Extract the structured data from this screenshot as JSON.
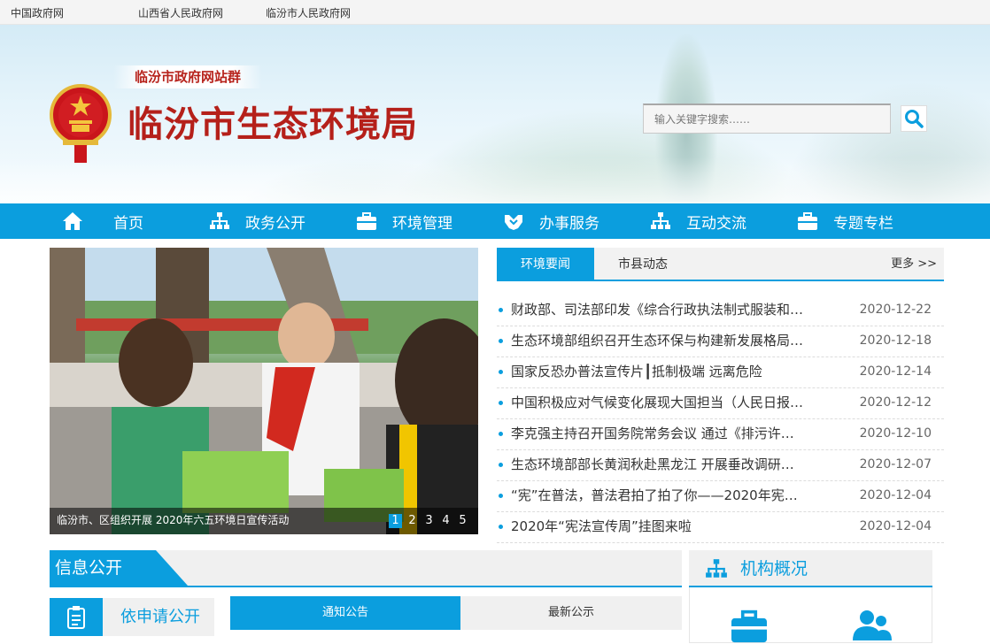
{
  "topbar": {
    "links": [
      "中国政府网",
      "山西省人民政府网",
      "临汾市人民政府网"
    ]
  },
  "header": {
    "group_tag": "临汾市政府网站群",
    "title": "临汾市生态环境局",
    "search_placeholder": "输入关键字搜索……"
  },
  "nav": {
    "items": [
      {
        "label": "首页",
        "icon": "home-icon"
      },
      {
        "label": "政务公开",
        "icon": "sitemap-icon"
      },
      {
        "label": "环境管理",
        "icon": "briefcase-icon"
      },
      {
        "label": "办事服务",
        "icon": "handshake-icon"
      },
      {
        "label": "互动交流",
        "icon": "sitemap-icon"
      },
      {
        "label": "专题专栏",
        "icon": "briefcase-icon"
      }
    ]
  },
  "slideshow": {
    "caption": "临汾市、区组织开展 2020年六五环境日宣传活动",
    "pages": [
      "1",
      "2",
      "3",
      "4",
      "5"
    ],
    "active_page": 1
  },
  "news": {
    "tabs": [
      "环境要闻",
      "市县动态"
    ],
    "active_tab": 0,
    "more_label": "更多 >>",
    "items": [
      {
        "title": "财政部、司法部印发《综合行政执法制式服装和…",
        "date": "2020-12-22"
      },
      {
        "title": "生态环境部组织召开生态环保与构建新发展格局…",
        "date": "2020-12-18"
      },
      {
        "title": "国家反恐办普法宣传片┃抵制极端 远离危险",
        "date": "2020-12-14"
      },
      {
        "title": "中国积极应对气候变化展现大国担当（人民日报…",
        "date": "2020-12-12"
      },
      {
        "title": "李克强主持召开国务院常务会议 通过《排污许…",
        "date": "2020-12-10"
      },
      {
        "title": "生态环境部部长黄润秋赴黑龙江 开展垂改调研…",
        "date": "2020-12-07"
      },
      {
        "title": "“宪”在普法，普法君拍了拍了你——2020年宪…",
        "date": "2020-12-04"
      },
      {
        "title": "2020年“宪法宣传周”挂图来啦",
        "date": "2020-12-04"
      }
    ]
  },
  "info": {
    "title": "信息公开",
    "apply_label": "依申请公开",
    "sub_tabs": [
      "通知公告",
      "最新公示"
    ],
    "active_sub_tab": 0
  },
  "org": {
    "title": "机构概况"
  },
  "colors": {
    "accent": "#0b9ede",
    "title_red": "#b5201a"
  }
}
